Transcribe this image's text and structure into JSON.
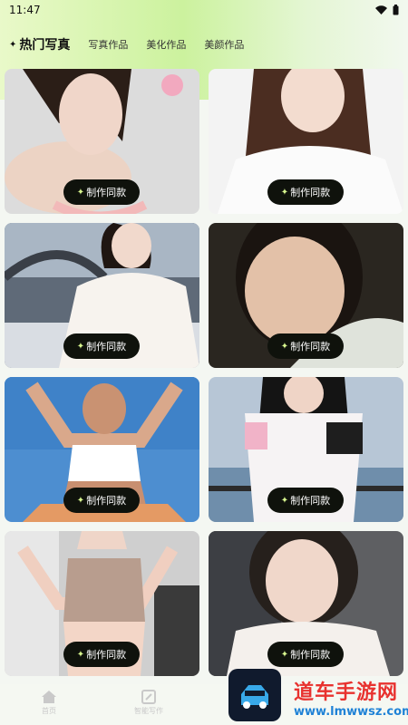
{
  "status_bar": {
    "time": "11:47"
  },
  "tabs": [
    {
      "label": "热门写真",
      "active": true
    },
    {
      "label": "写真作品",
      "active": false
    },
    {
      "label": "美化作品",
      "active": false
    },
    {
      "label": "美颜作品",
      "active": false
    }
  ],
  "cards": [
    {
      "button_label": "制作同款"
    },
    {
      "button_label": "制作同款"
    },
    {
      "button_label": "制作同款"
    },
    {
      "button_label": "制作同款"
    },
    {
      "button_label": "制作同款"
    },
    {
      "button_label": "制作同款"
    },
    {
      "button_label": "制作同款"
    },
    {
      "button_label": "制作同款"
    }
  ],
  "bottom_nav": [
    {
      "label": "首页",
      "icon": "home-icon"
    },
    {
      "label": "智能写作",
      "icon": "edit-icon"
    }
  ],
  "watermark": {
    "title": "道车手游网",
    "url": "www.lmwwsz.com"
  },
  "colors": {
    "accent": "#ccf29e",
    "button_bg": "#0f120c",
    "watermark_red": "#e8322f",
    "watermark_blue": "#1f82d6"
  }
}
